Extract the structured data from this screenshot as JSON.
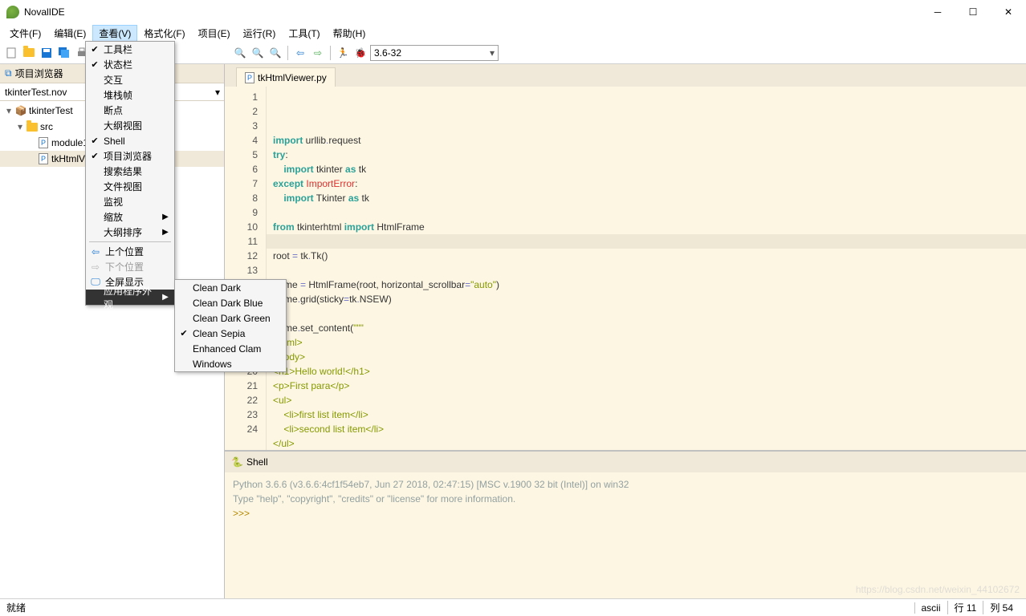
{
  "window": {
    "title": "NovalIDE"
  },
  "menu": {
    "items": [
      "文件(F)",
      "编辑(E)",
      "查看(V)",
      "格式化(F)",
      "项目(E)",
      "运行(R)",
      "工具(T)",
      "帮助(H)"
    ],
    "active": 2
  },
  "toolbar": {
    "pyver": "3.6-32"
  },
  "viewMenu": {
    "items": [
      {
        "label": "工具栏",
        "check": true
      },
      {
        "label": "状态栏",
        "check": true
      },
      {
        "label": "交互"
      },
      {
        "label": "堆栈帧"
      },
      {
        "label": "断点"
      },
      {
        "label": "大纲视图"
      },
      {
        "label": "Shell",
        "check": true
      },
      {
        "label": "项目浏览器",
        "check": true
      },
      {
        "label": "搜索结果"
      },
      {
        "label": "文件视图"
      },
      {
        "label": "监视"
      },
      {
        "label": "缩放",
        "sub": true
      },
      {
        "label": "大纲排序",
        "sub": true
      },
      {
        "sep": true
      },
      {
        "label": "上个位置",
        "icon": "back"
      },
      {
        "label": "下个位置",
        "icon": "fwd",
        "disabled": true
      },
      {
        "label": "全屏显示",
        "icon": "screen"
      },
      {
        "label": "应用程序外观",
        "sub": true,
        "hl": true
      }
    ]
  },
  "themeMenu": {
    "items": [
      {
        "label": "Clean Dark"
      },
      {
        "label": "Clean Dark Blue"
      },
      {
        "label": "Clean Dark Green"
      },
      {
        "label": "Clean Sepia",
        "check": true
      },
      {
        "label": "Enhanced Clam"
      },
      {
        "label": "Windows"
      }
    ]
  },
  "sidebar": {
    "title": "项目浏览器",
    "project": "tkinterTest.nov",
    "tree": [
      {
        "label": "tkinterTest",
        "icon": "pkg",
        "exp": "▾",
        "ind": 0
      },
      {
        "label": "src",
        "icon": "folder",
        "exp": "▾",
        "ind": 1
      },
      {
        "label": "module1",
        "icon": "py",
        "ind": 2
      },
      {
        "label": "tkHtmlV",
        "icon": "py",
        "ind": 2,
        "sel": true
      }
    ]
  },
  "tabs": {
    "file": "tkHtmlViewer.py"
  },
  "code": {
    "lines": [
      1,
      2,
      3,
      4,
      5,
      6,
      7,
      8,
      9,
      10,
      11,
      12,
      13,
      "",
      "",
      "",
      "",
      "",
      "",
      20,
      21,
      22,
      23,
      24
    ]
  },
  "shell": {
    "tab": "Shell",
    "line1": "Python 3.6.6 (v3.6.6:4cf1f54eb7, Jun 27 2018, 02:47:15) [MSC v.1900 32 bit (Intel)] on win32",
    "line2": "Type \"help\", \"copyright\", \"credits\" or \"license\" for more information.",
    "prompt": ">>>"
  },
  "status": {
    "ready": "就绪",
    "enc": "ascii",
    "line": "行 11",
    "col": "列 54"
  },
  "watermark": "https://blog.csdn.net/weixin_44102672"
}
